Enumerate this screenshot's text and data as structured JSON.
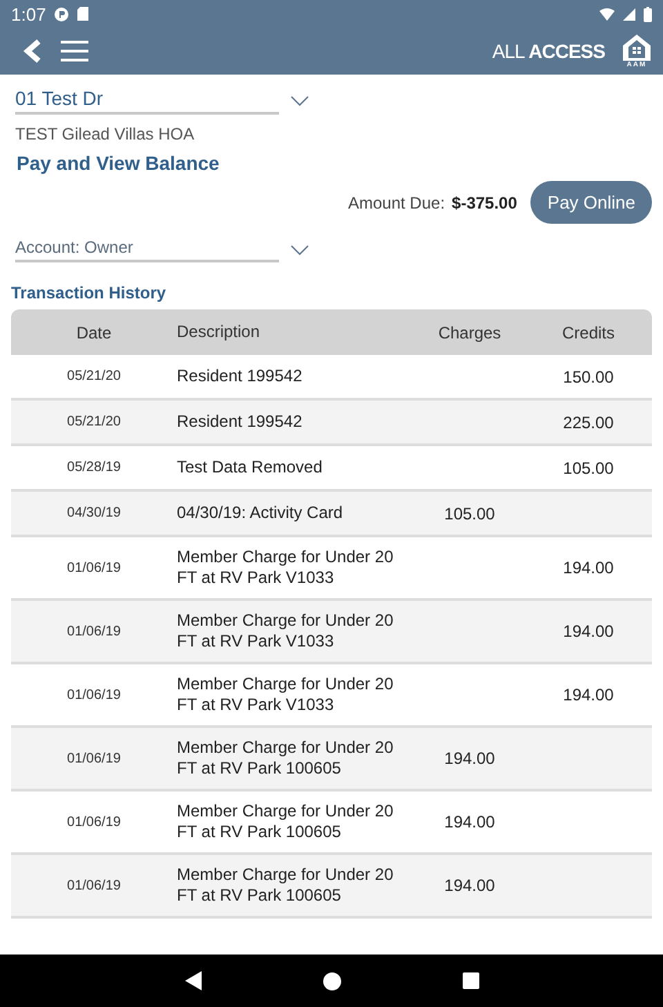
{
  "status_bar": {
    "time": "1:07"
  },
  "app_bar": {
    "brand": "ALL",
    "brand_bold": "ACCESS",
    "logo_text": "AAM"
  },
  "property_select": {
    "value": "01 Test Dr"
  },
  "association": "TEST Gilead Villas HOA",
  "page_title": "Pay and View Balance",
  "amount_due": {
    "label": "Amount Due:",
    "value": "$-375.00"
  },
  "pay_button": "Pay Online",
  "account_select": {
    "value": "Account: Owner"
  },
  "section_title": "Transaction History",
  "table": {
    "columns": [
      "Date",
      "Description",
      "Charges",
      "Credits"
    ],
    "rows": [
      {
        "date": "05/21/20",
        "description": "Resident 199542",
        "charges": "",
        "credits": "150.00"
      },
      {
        "date": "05/21/20",
        "description": "Resident 199542",
        "charges": "",
        "credits": "225.00"
      },
      {
        "date": "05/28/19",
        "description": "Test Data Removed",
        "charges": "",
        "credits": "105.00"
      },
      {
        "date": "04/30/19",
        "description": "04/30/19: Activity Card",
        "charges": "105.00",
        "credits": ""
      },
      {
        "date": "01/06/19",
        "description": "Member Charge for Under 20 FT at RV Park V1033",
        "charges": "",
        "credits": "194.00"
      },
      {
        "date": "01/06/19",
        "description": "Member Charge for Under 20 FT at RV Park V1033",
        "charges": "",
        "credits": "194.00"
      },
      {
        "date": "01/06/19",
        "description": "Member Charge for Under 20 FT at RV Park V1033",
        "charges": "",
        "credits": "194.00"
      },
      {
        "date": "01/06/19",
        "description": "Member Charge for Under 20 FT at RV Park 100605",
        "charges": "194.00",
        "credits": ""
      },
      {
        "date": "01/06/19",
        "description": "Member Charge for Under 20 FT at RV Park 100605",
        "charges": "194.00",
        "credits": ""
      },
      {
        "date": "01/06/19",
        "description": "Member Charge for Under 20 FT at RV Park 100605",
        "charges": "194.00",
        "credits": ""
      }
    ]
  }
}
